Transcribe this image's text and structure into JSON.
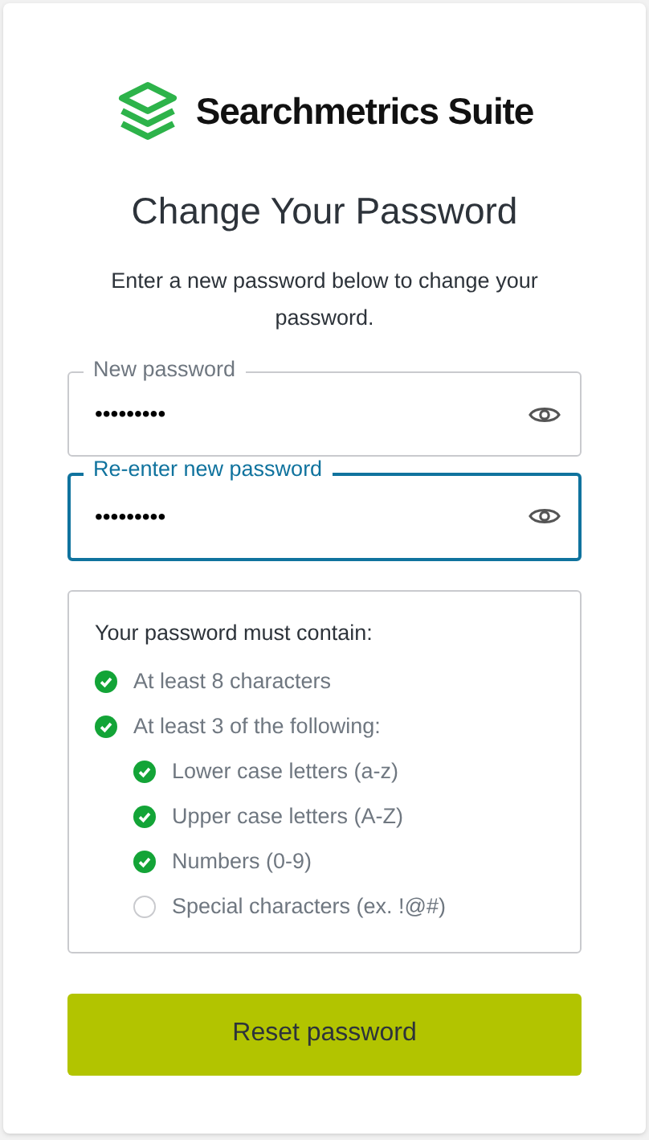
{
  "logo": {
    "text": "Searchmetrics Suite"
  },
  "title": "Change Your Password",
  "subtitle": "Enter a new password below to change your password.",
  "fields": [
    {
      "label": "New password",
      "value": "•••••••••",
      "focused": false
    },
    {
      "label": "Re-enter new password",
      "value": "•••••••••",
      "focused": true
    }
  ],
  "requirements": {
    "heading": "Your password must contain:",
    "rules": [
      {
        "text": "At least 8 characters",
        "met": true
      },
      {
        "text": "At least 3 of the following:",
        "met": true,
        "children": [
          {
            "text": "Lower case letters (a-z)",
            "met": true
          },
          {
            "text": "Upper case letters (A-Z)",
            "met": true
          },
          {
            "text": "Numbers (0-9)",
            "met": true
          },
          {
            "text": "Special characters (ex. !@#)",
            "met": false
          }
        ]
      }
    ]
  },
  "button": "Reset password"
}
